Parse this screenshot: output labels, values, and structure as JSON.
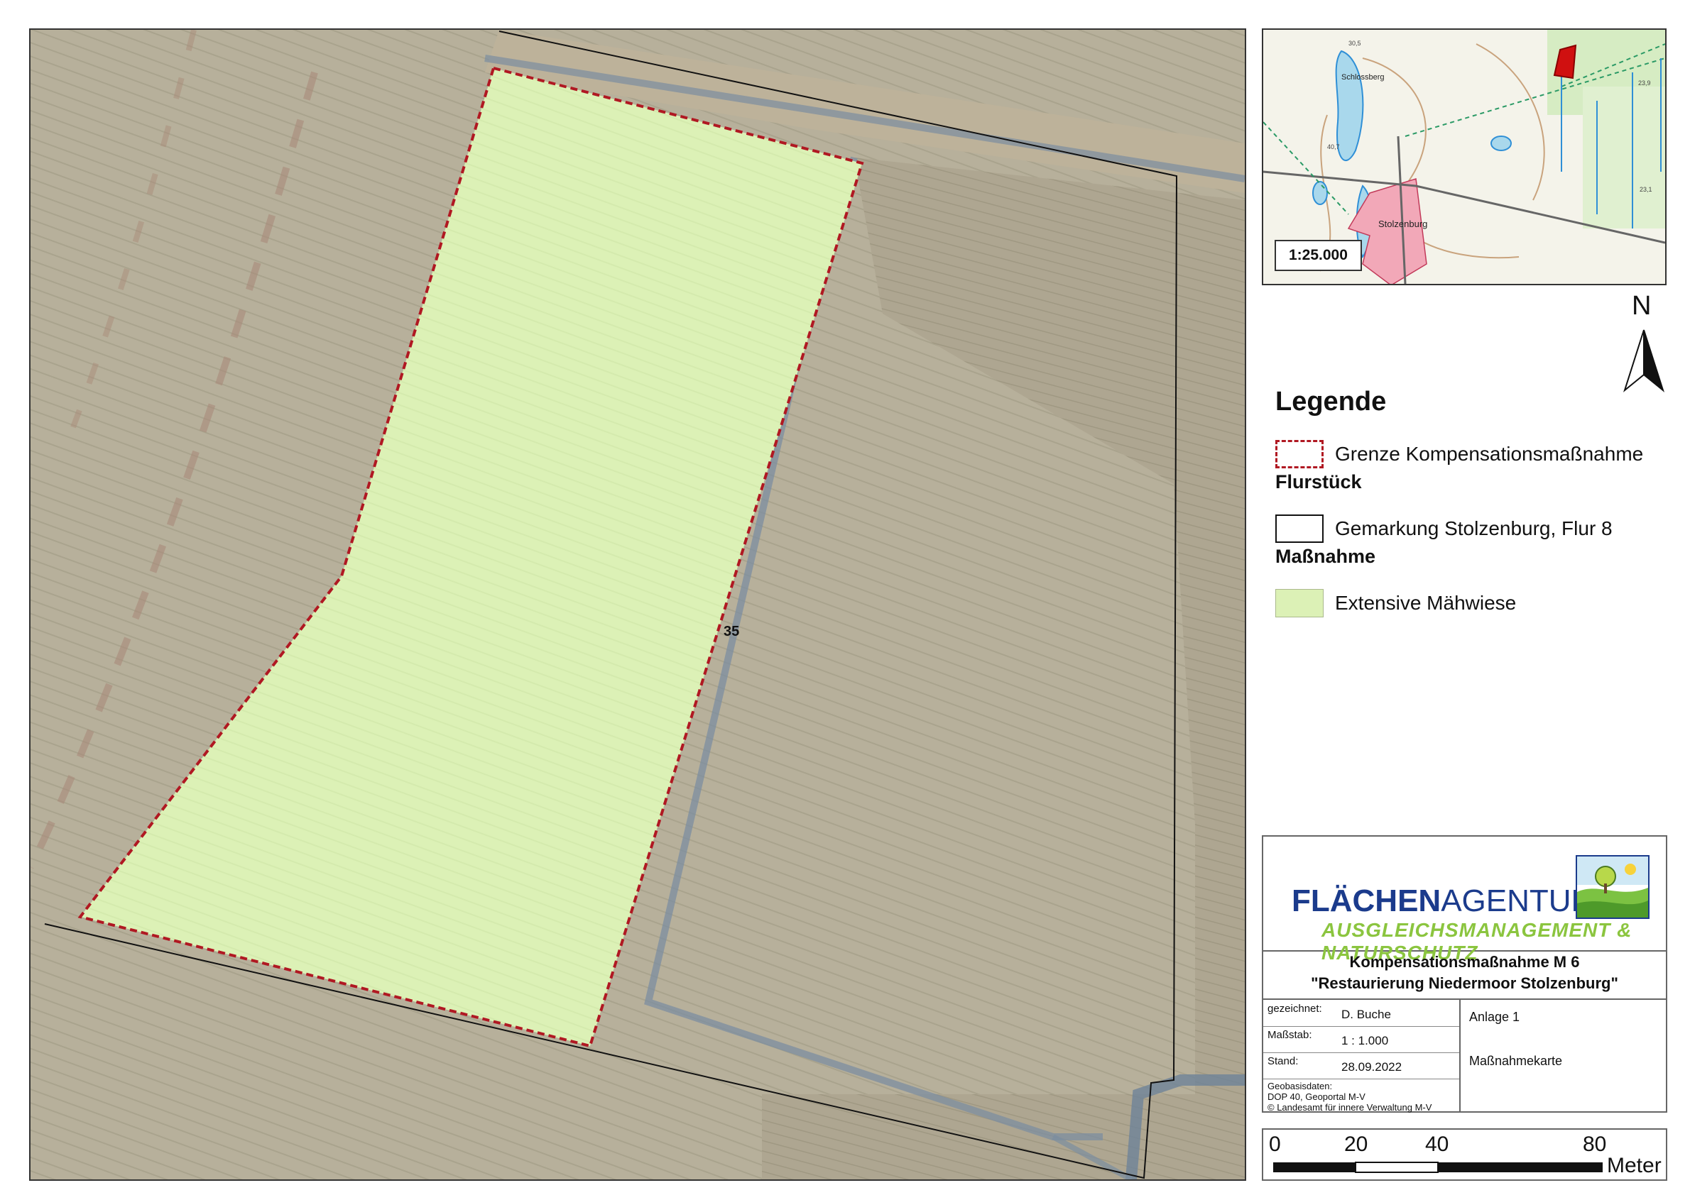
{
  "map": {
    "parcel_label": "35",
    "colors": {
      "field": "#b8b29c",
      "meadow": "#dcf1b6",
      "boundary_red": "#b01822",
      "parcel_line": "#111111",
      "ditch": "#7c8ea0"
    }
  },
  "overview": {
    "scale": "1:25.000",
    "place_labels": [
      "Schlossberg",
      "Stolzenburg"
    ],
    "small_labels": [
      "30,5",
      "23,9",
      "40,7",
      "23,1"
    ]
  },
  "north_arrow": {
    "letter": "N"
  },
  "legend": {
    "title": "Legende",
    "boundary_label": "Grenze Kompensationsmaßnahme",
    "parcel_heading": "Flurstück",
    "parcel_label": "Gemarkung Stolzenburg, Flur 8",
    "measure_heading": "Maßnahme",
    "measure_label": "Extensive Mähwiese"
  },
  "title_block": {
    "logo_main_bold": "FLÄCHEN",
    "logo_main_rest": "AGENTUR MV",
    "logo_sub": "AUSGLEICHSMANAGEMENT & NATURSCHUTZ",
    "title_line1": "Kompensationsmaßnahme M 6",
    "title_line2": "\"Restaurierung Niedermoor Stolzenburg\"",
    "drawn_by_key": "gezeichnet:",
    "drawn_by_value": "D. Buche",
    "scale_key": "Maßstab:",
    "scale_value": "1 : 1.000",
    "date_key": "Stand:",
    "date_value": "28.09.2022",
    "source_line1": "Geobasisdaten:",
    "source_line2": "DOP 40, Geoportal M-V",
    "source_line3": "© Landesamt für innere Verwaltung M-V",
    "annex": "Anlage 1",
    "map_type": "Maßnahmekarte"
  },
  "scale_bar": {
    "ticks": [
      "0",
      "20",
      "40",
      "80"
    ],
    "unit": "Meter"
  }
}
